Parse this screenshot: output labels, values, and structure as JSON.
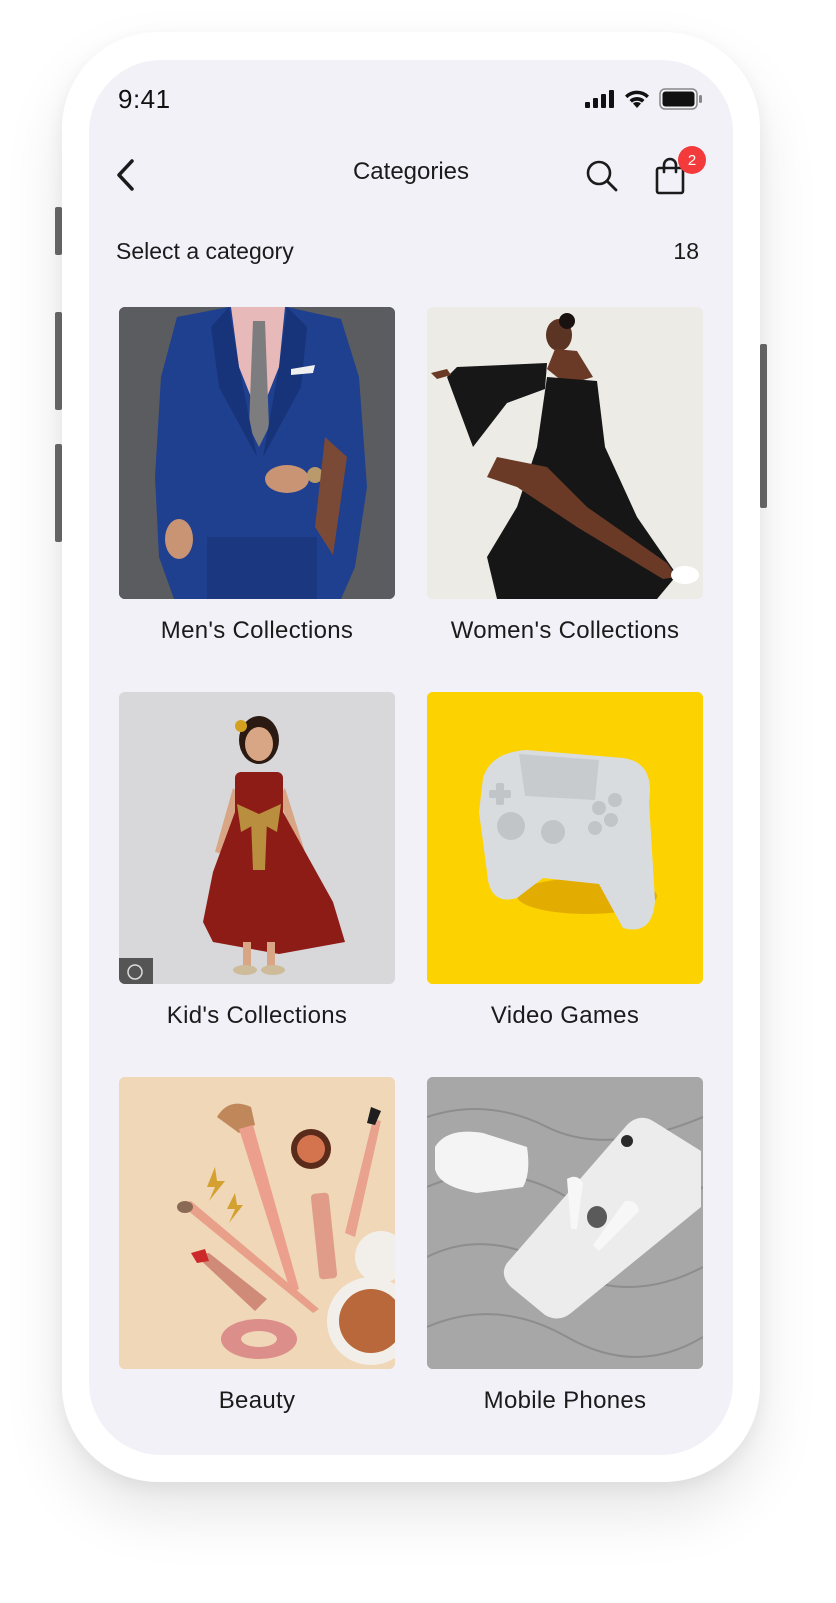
{
  "status_bar": {
    "time": "9:41"
  },
  "nav": {
    "title": "Categories",
    "cart_count": "2"
  },
  "section": {
    "label": "Select a category",
    "count": "18"
  },
  "categories": [
    {
      "label": "Men's Collections",
      "image": "mens-suit-photo",
      "bg": "#5a5c60"
    },
    {
      "label": "Women's Collections",
      "image": "womens-dress-photo",
      "bg": "#ecebe6"
    },
    {
      "label": "Kid's Collections",
      "image": "kids-dress-photo",
      "bg": "#d8d8da"
    },
    {
      "label": "Video Games",
      "image": "game-controller-photo",
      "bg": "#fcd200"
    },
    {
      "label": "Beauty",
      "image": "makeup-products-photo",
      "bg": "#efd7b7"
    },
    {
      "label": "Mobile Phones",
      "image": "phone-earbuds-photo",
      "bg": "#a7a7a7"
    }
  ],
  "colors": {
    "screen_bg": "#f2f1f8",
    "badge": "#f43b3b",
    "text": "#1b1b1b"
  },
  "icons": {
    "back": "chevron-left-icon",
    "search": "search-icon",
    "cart": "shopping-bag-icon",
    "signal": "signal-icon",
    "wifi": "wifi-icon",
    "battery": "battery-icon"
  }
}
